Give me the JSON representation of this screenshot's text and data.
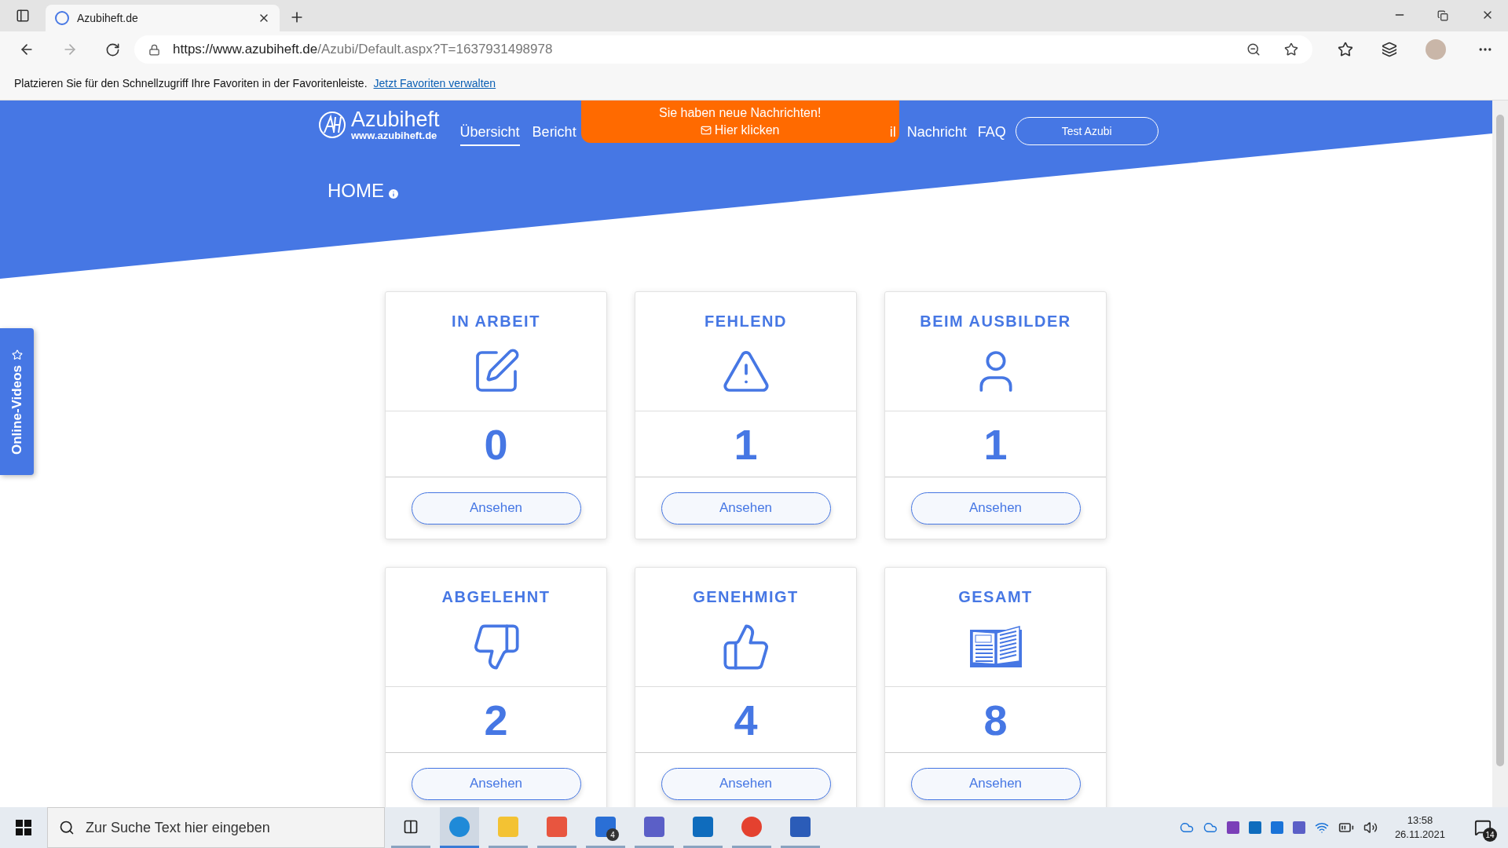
{
  "browser": {
    "tab_title": "Azubiheft.de",
    "url": {
      "host": "https://www.azubiheft.de",
      "path": "/Azubi/Default.aspx?T=1637931498978"
    },
    "favorites_bar": {
      "message": "Platzieren Sie für den Schnellzugriff Ihre Favoriten in der Favoritenleiste.",
      "link": "Jetzt Favoriten verwalten"
    }
  },
  "header": {
    "logo": {
      "name": "Azubiheft",
      "url": "www.azubiheft.de"
    },
    "nav_left": [
      {
        "label": "Übersicht",
        "selected": true
      },
      {
        "label": "Bericht",
        "selected": false
      }
    ],
    "notice": {
      "title": "Sie haben neue Nachrichten!",
      "link": "Hier klicken"
    },
    "nav_right": [
      {
        "label": "il",
        "selected": false
      },
      {
        "label": "Nachricht",
        "selected": false
      },
      {
        "label": "FAQ",
        "selected": false
      }
    ],
    "user_button": "Test Azubi",
    "page_title": "HOME"
  },
  "side_tab": "Online-Videos",
  "cards": [
    {
      "kind": "edit",
      "title": "IN ARBEIT",
      "count": "0",
      "button": "Ansehen"
    },
    {
      "kind": "warning",
      "title": "FEHLEND",
      "count": "1",
      "button": "Ansehen"
    },
    {
      "kind": "person",
      "title": "BEIM AUSBILDER",
      "count": "1",
      "button": "Ansehen"
    },
    {
      "kind": "thumbs_down",
      "title": "ABGELEHNT",
      "count": "2",
      "button": "Ansehen"
    },
    {
      "kind": "thumbs_up",
      "title": "GENEHMIGT",
      "count": "4",
      "button": "Ansehen"
    },
    {
      "kind": "book",
      "title": "GESAMT",
      "count": "8",
      "button": "Ansehen"
    }
  ],
  "taskbar": {
    "search_placeholder": "Zur Suche Text hier eingeben",
    "apps": [
      {
        "kind": "task_view",
        "selected": false
      },
      {
        "kind": "edge",
        "selected": true
      },
      {
        "kind": "explorer",
        "selected": false
      },
      {
        "kind": "store",
        "selected": false
      },
      {
        "kind": "todo",
        "selected": false,
        "badge": "4"
      },
      {
        "kind": "teams",
        "selected": false
      },
      {
        "kind": "outlook",
        "selected": false
      },
      {
        "kind": "chrome",
        "selected": false
      },
      {
        "kind": "word",
        "selected": false
      }
    ],
    "time": "13:58",
    "date": "26.11.2021",
    "notifications": "14"
  }
}
